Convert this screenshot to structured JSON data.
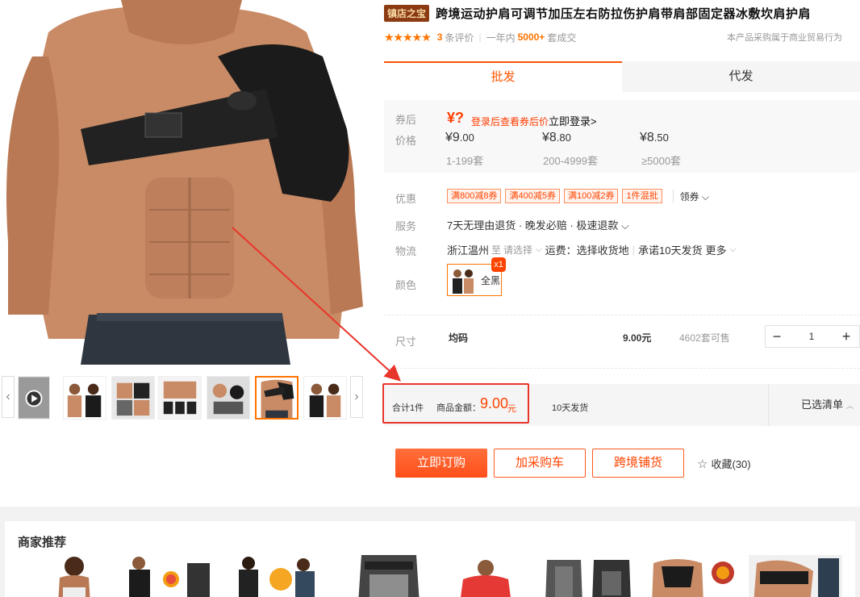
{
  "product": {
    "shop_badge": "镇店之宝",
    "title": "跨境运动护肩可调节加压左右防拉伤护肩带肩部固定器冰敷坎肩护肩",
    "stars": "★★★★★",
    "review_count": "3",
    "review_unit": "条评价",
    "deals_period": "一年内",
    "deals_count": "5000+",
    "deals_unit": "套成交",
    "notice": "本产品采购属于商业贸易行为"
  },
  "tabs": [
    {
      "label": "批发",
      "active": true
    },
    {
      "label": "代发",
      "active": false
    }
  ],
  "pricing": {
    "coupon_label": "券后",
    "coupon_value": "¥?",
    "coupon_hint": "登录后查看券后价",
    "coupon_login": "立即登录>",
    "price_label": "价格",
    "tiers": [
      {
        "price_int": "¥9",
        "price_dec": ".00",
        "range": "1-199套"
      },
      {
        "price_int": "¥8",
        "price_dec": ".80",
        "range": "200-4999套"
      },
      {
        "price_int": "¥8",
        "price_dec": ".50",
        "range": "≥5000套"
      }
    ]
  },
  "promotions": {
    "label": "优惠",
    "items": [
      "满800减8券",
      "满400减5券",
      "满100减2券",
      "1件混批"
    ],
    "get_coupon": "领券 ⌵"
  },
  "service": {
    "label": "服务",
    "text": "7天无理由退货 · 晚发必赔 · 极速退款 ⌵"
  },
  "logistics": {
    "label": "物流",
    "origin": "浙江温州",
    "to": "至",
    "destination": "请选择",
    "shipping": "运费：选择收货地",
    "promise": "承诺10天发货",
    "more": "更多"
  },
  "color": {
    "label": "颜色",
    "option_name": "全黑",
    "option_qty": "x1"
  },
  "size": {
    "label": "尺寸",
    "name": "均码",
    "price": "9.00元",
    "stock": "4602套可售",
    "quantity": "1",
    "minus": "−",
    "plus": "+"
  },
  "summary": {
    "count": "合计1件",
    "amount_label": "商品金额：",
    "amount": "9.00",
    "unit": "元",
    "ship": "10天发货",
    "selected_list": "已选清单"
  },
  "actions": {
    "order": "立即订购",
    "add_cart": "加采购车",
    "distribute": "跨境铺货",
    "favorite": "收藏(30)"
  },
  "recommendations": {
    "title": "商家推荐",
    "item_count": 8
  },
  "colors": {
    "accent": "#ff5500",
    "highlight_box": "#e8352b",
    "shop_badge_bg": "#8b3a12"
  }
}
